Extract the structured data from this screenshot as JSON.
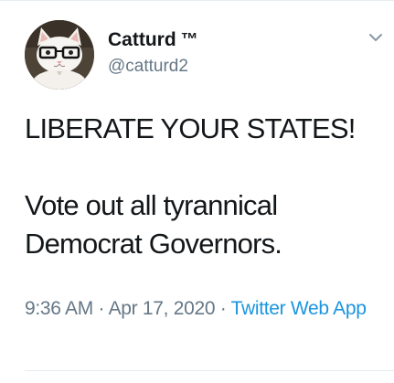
{
  "author": {
    "display_name": "Catturd",
    "badge": "™",
    "handle": "@catturd2",
    "avatar_icon": "cat-with-glasses-avatar"
  },
  "menu": {
    "icon": "chevron-down-icon"
  },
  "tweet": {
    "line1": "LIBERATE YOUR STATES!",
    "line2": "Vote out all tyrannical Democrat Governors."
  },
  "meta": {
    "time": "9:36 AM",
    "separator1": " · ",
    "date": "Apr 17, 2020",
    "separator2": " · ",
    "source": "Twitter Web App"
  },
  "colors": {
    "text": "#14171a",
    "secondary": "#657786",
    "link": "#1b95e0",
    "divider": "#e6ecf0"
  }
}
